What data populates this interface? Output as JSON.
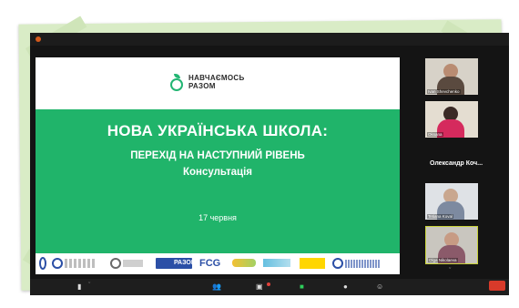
{
  "slide": {
    "logo_line1": "НАВЧАЄМОСЬ",
    "logo_line2": "РАЗОМ",
    "title": "НОВА УКРАЇНСЬКА ШКОЛА:",
    "subtitle": "ПЕРЕХІД НА НАСТУПНИЙ РІВЕНЬ",
    "subtitle2": "Консультація",
    "date": "17 червня",
    "partners": {
      "eu_label": "РАЗОМ",
      "fcg_label": "FCG"
    }
  },
  "participants": {
    "tile1_name": "Ivan Shevchenko",
    "tile2_name": "Oksana",
    "speaker_name": "Олександр Коч...",
    "tile3_name": "Tetiana Koval",
    "tile4_name": "Olga Nikolaeva"
  },
  "toolbar": {
    "mic_icon": "▮",
    "video_icon": "▬",
    "participants_icon": "👥",
    "chat_icon": "▣",
    "share_icon": "■",
    "record_icon": "●",
    "reactions_icon": "☺",
    "chev": "ˇ"
  },
  "colors": {
    "slide_green": "#20b46a",
    "frame_green": "#d9ecc6",
    "active_speaker_border": "#c8d23a",
    "share_green": "#2fcf5c",
    "leave_red": "#d83a2a"
  }
}
